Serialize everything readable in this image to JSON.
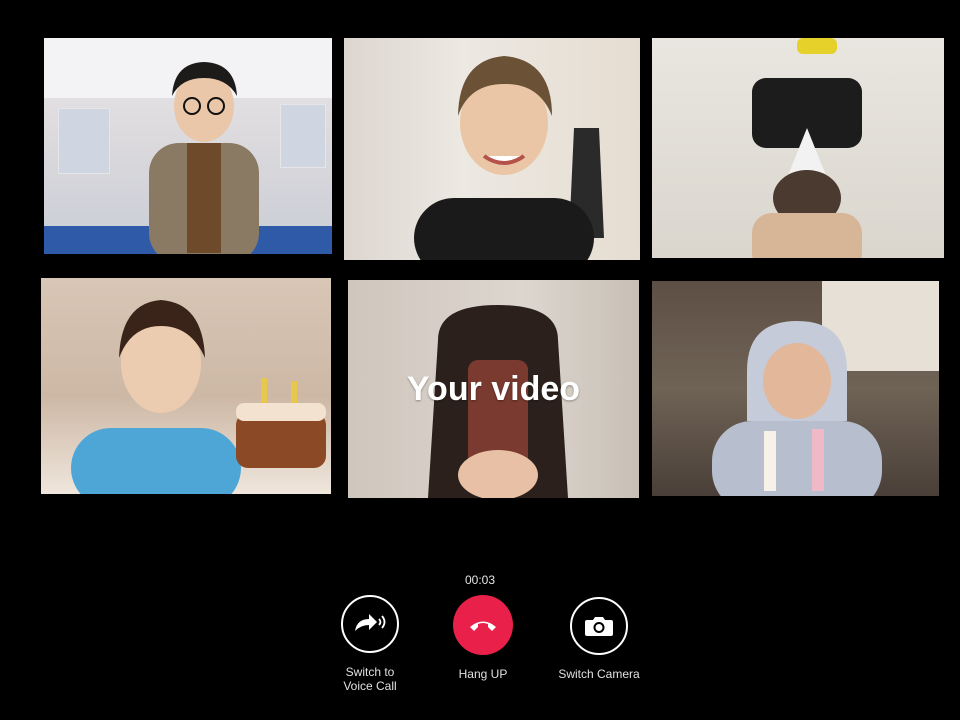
{
  "participants": [
    {
      "id": "p1",
      "kind": "remote"
    },
    {
      "id": "p2",
      "kind": "remote"
    },
    {
      "id": "p3",
      "kind": "remote"
    },
    {
      "id": "p4",
      "kind": "remote"
    },
    {
      "id": "p5",
      "kind": "self",
      "label": "Your video"
    },
    {
      "id": "p6",
      "kind": "remote"
    }
  ],
  "call": {
    "timer": "00:03"
  },
  "controls": {
    "voice_label_line1": "Switch to",
    "voice_label_line2": "Voice Call",
    "hang_label": "Hang UP",
    "camera_label": "Switch Camera"
  },
  "colors": {
    "background": "#000000",
    "hang_up": "#e8204a",
    "control_outline": "#ffffff"
  },
  "icons": {
    "voice": "voice-call-icon",
    "hang": "phone-hangup-icon",
    "camera": "camera-icon"
  }
}
